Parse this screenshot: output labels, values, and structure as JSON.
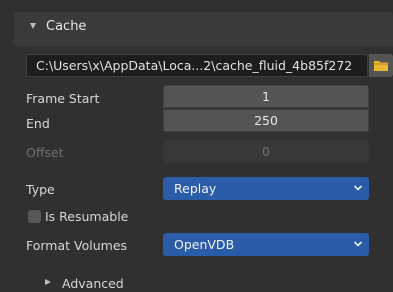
{
  "panel": {
    "title": "Cache",
    "directory": "C:\\Users\\x\\AppData\\Loca...2\\cache_fluid_4b85f272",
    "frame_start": {
      "label": "Frame Start",
      "value": "1"
    },
    "frame_end": {
      "label": "End",
      "value": "250"
    },
    "offset": {
      "label": "Offset",
      "value": "0"
    },
    "type": {
      "label": "Type",
      "value": "Replay"
    },
    "is_resumable": {
      "label": "Is Resumable",
      "checked": false
    },
    "format_volumes": {
      "label": "Format Volumes",
      "value": "OpenVDB"
    },
    "advanced": {
      "label": "Advanced"
    }
  },
  "icons": [
    "collapse-triangle-icon",
    "folder-icon",
    "chevron-down-icon",
    "expand-triangle-icon"
  ],
  "colors": {
    "background": "#303030",
    "accent": "#2a5ca8",
    "folder": "#e8b830"
  }
}
